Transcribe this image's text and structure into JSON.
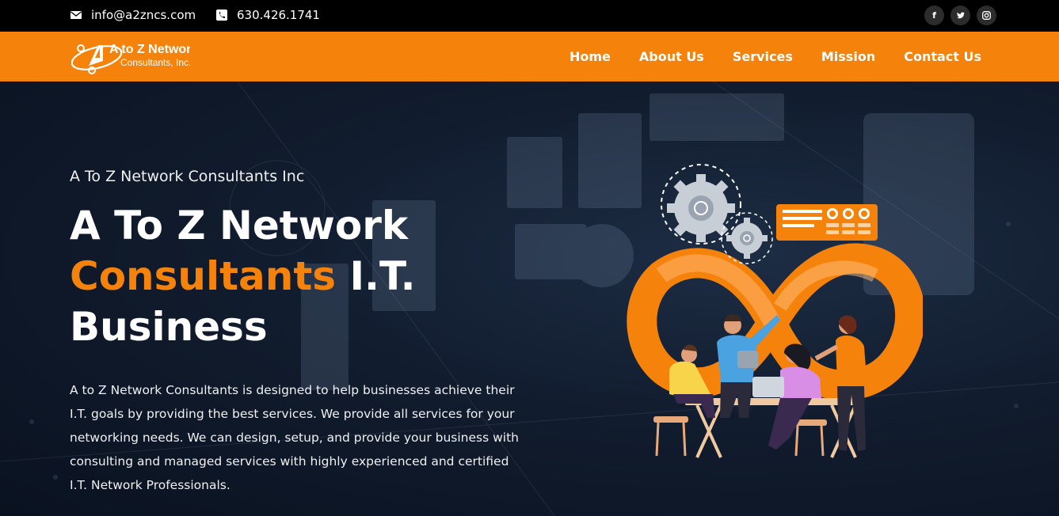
{
  "topbar": {
    "email": "info@a2zncs.com",
    "phone": "630.426.1741",
    "social": [
      {
        "icon": "facebook-icon",
        "glyph": "f"
      },
      {
        "icon": "twitter-icon",
        "glyph": "t"
      },
      {
        "icon": "instagram-icon",
        "glyph": "◎"
      }
    ]
  },
  "brand": {
    "line1": "A to Z Network",
    "line2": "Consultants, Inc."
  },
  "nav": {
    "items": [
      "Home",
      "About Us",
      "Services",
      "Mission",
      "Contact Us"
    ]
  },
  "hero": {
    "subtitle": "A To Z Network Consultants Inc",
    "title_line1": "A To Z Network",
    "title_accent": "Consultants",
    "title_rest": " I.T.",
    "title_line3": "Business",
    "description": "A to Z Network Consultants is designed to help businesses achieve their I.T. goals by providing the best services. We provide all services for your networking needs. We can design, setup, and provide your business with consulting and managed services with highly experienced and certified I.T. Network Professionals."
  },
  "colors": {
    "accent": "#f5820a",
    "topbar": "#000000",
    "hero_bg": "#111c2e"
  }
}
